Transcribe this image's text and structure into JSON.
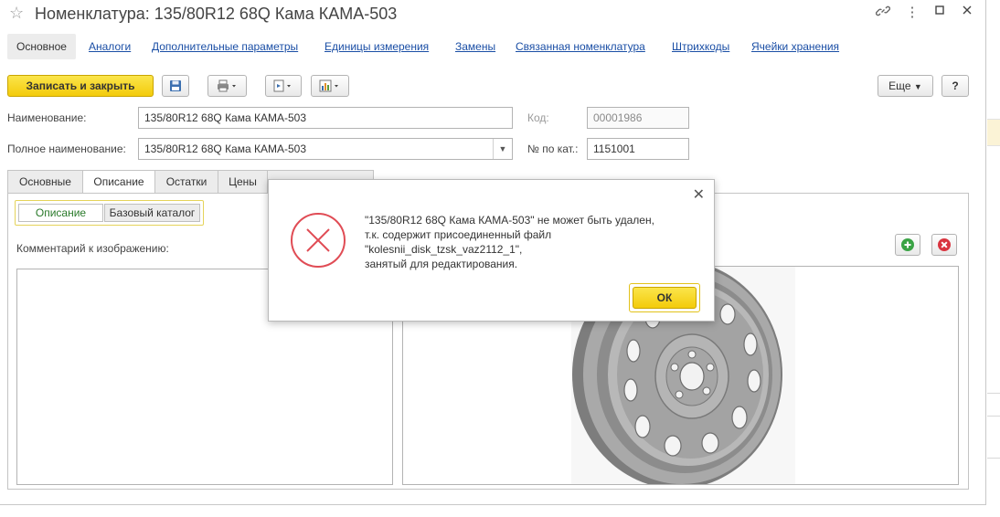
{
  "window": {
    "title": "Номенклатура: 135/80R12 68Q Кама КАМА-503",
    "star_icon": "☆",
    "link_icon": "🔗",
    "more_icon": "⋮",
    "restore_icon": "□",
    "close_icon": "✕"
  },
  "nav_tabs": [
    {
      "label": "Основное",
      "active": true
    },
    {
      "label": "Аналоги"
    },
    {
      "label": "Дополнительные параметры"
    },
    {
      "label": "Единицы измерения"
    },
    {
      "label": "Замены"
    },
    {
      "label": "Связанная номенклатура"
    },
    {
      "label": "Штрихкоды"
    },
    {
      "label": "Ячейки хранения"
    }
  ],
  "toolbar": {
    "save_close_label": "Записать и закрыть",
    "more_label": "Еще",
    "help_label": "?"
  },
  "fields": {
    "name_label": "Наименование:",
    "name_value": "135/80R12 68Q Кама КАМА-503",
    "full_name_label": "Полное наименование:",
    "full_name_value": "135/80R12 68Q Кама КАМА-503",
    "code_label": "Код:",
    "code_value": "00001986",
    "cat_no_label": "№ по кат.:",
    "cat_no_value": "1151001"
  },
  "form_tabs": [
    {
      "label": "Основные"
    },
    {
      "label": "Описание",
      "active": true
    },
    {
      "label": "Остатки"
    },
    {
      "label": "Цены"
    }
  ],
  "sub_tabs": [
    {
      "label": "Описание",
      "active": true
    },
    {
      "label": "Базовый каталог"
    }
  ],
  "comment_label": "Комментарий к изображению:",
  "dialog": {
    "lines": [
      "\"135/80R12 68Q Кама КАМА-503\" не может быть удален,",
      "т.к. содержит присоединенный файл",
      "\"kolesnii_disk_tzsk_vaz2112_1\",",
      "занятый для редактирования."
    ],
    "ok_label": "ОК",
    "close_icon": "✕"
  },
  "colors": {
    "accent_yellow": "#f5d020",
    "error_red": "#e04c55",
    "link_blue": "#1a4ea5",
    "active_green": "#2a7a2a"
  }
}
